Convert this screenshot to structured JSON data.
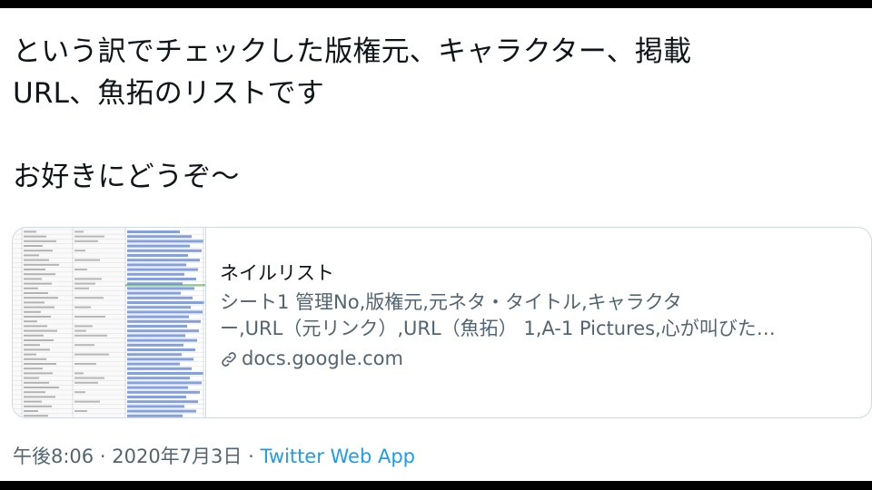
{
  "tweet": {
    "text_lines": [
      "という訳でチェックした版権元、キャラクター、掲載",
      "URL、魚拓のリストです",
      "お好きにどうぞ～"
    ]
  },
  "card": {
    "title": "ネイルリスト",
    "description_lines": [
      "シート1 管理No,版権元,元ネタ・タイトル,キャラクタ",
      "ー,URL（元リンク）,URL（魚拓） 1,A-1 Pictures,心が叫びた…"
    ],
    "domain": "docs.google.com",
    "domain_icon": "link-icon",
    "thumbnail": "spreadsheet-thumbnail"
  },
  "meta": {
    "time": "午後8:06",
    "separator": "·",
    "date": "2020年7月3日",
    "source": "Twitter Web App"
  },
  "colors": {
    "text_primary": "#0f1419",
    "text_secondary": "#536471",
    "link": "#1d9bf0",
    "border": "#cfd9de",
    "letterbox": "#000000",
    "sheet_link_cell": "#6f8fd8"
  }
}
